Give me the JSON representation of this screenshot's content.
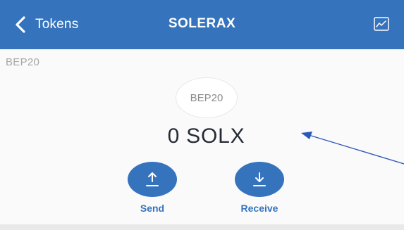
{
  "header": {
    "back_label": "Tokens",
    "title": "SOLERAX",
    "chart_icon": "chart-icon"
  },
  "token": {
    "network_label": "BEP20",
    "logo_text": "BEP20",
    "balance": "0 SOLX"
  },
  "actions": {
    "send_label": "Send",
    "receive_label": "Receive"
  },
  "colors": {
    "header_bg": "#3574bd",
    "accent": "#3574bd",
    "page_bg": "#fafafa",
    "arrow": "#2e58b8"
  }
}
